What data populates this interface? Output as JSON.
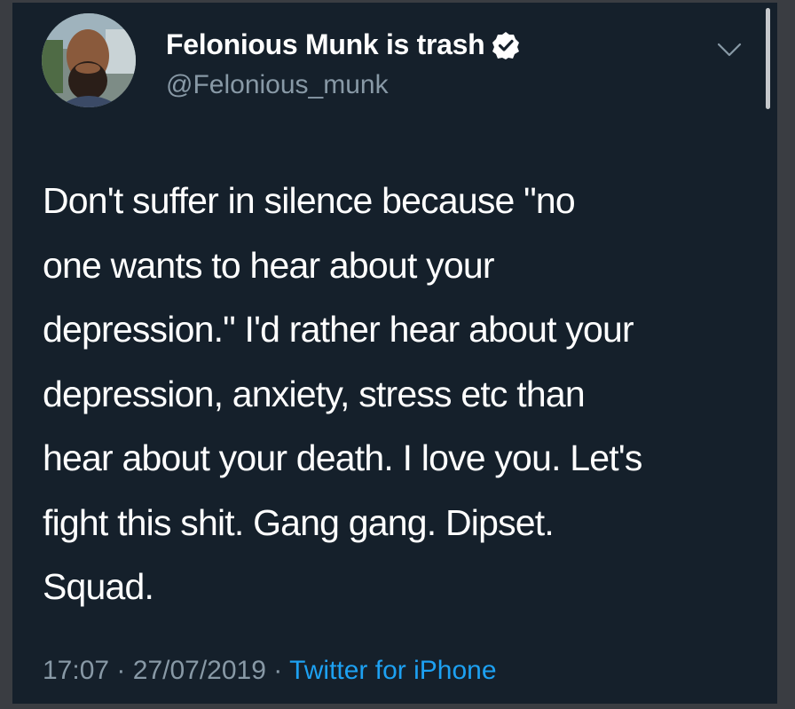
{
  "tweet": {
    "display_name": "Felonious Munk is trash",
    "handle": "@Felonious_munk",
    "text_lines": [
      "Don't suffer in silence because \"no",
      "one wants to hear about your",
      "depression.\" I'd rather hear about your",
      "depression, anxiety, stress etc than",
      "hear about your death. I love you. Let's",
      "fight this shit. Gang gang. Dipset.",
      "Squad."
    ],
    "time": "17:07",
    "separator": "·",
    "date": "27/07/2019",
    "source": "Twitter for iPhone"
  },
  "icons": {
    "avatar": "profile-photo",
    "verified": "verified-badge-icon",
    "menu": "chevron-down-icon"
  },
  "colors": {
    "background": "#15202b",
    "text": "#ffffff",
    "secondary": "#8899a6",
    "link": "#1da1f2"
  }
}
